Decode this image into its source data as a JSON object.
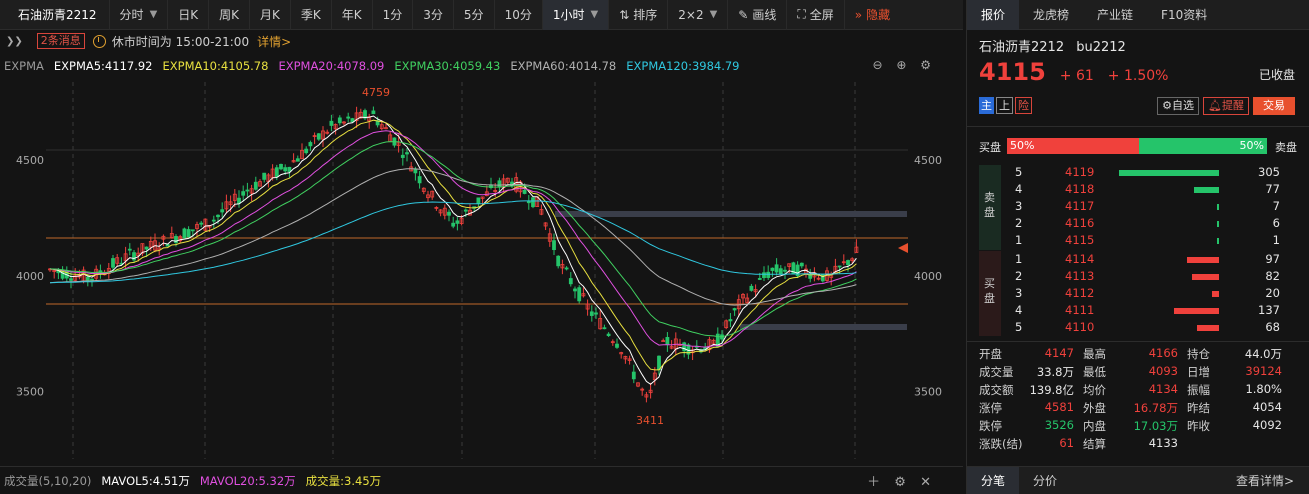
{
  "toolbar": {
    "title": "石油沥青2212",
    "items": [
      "分时",
      "日K",
      "周K",
      "月K",
      "季K",
      "年K",
      "1分",
      "3分",
      "5分",
      "10分",
      "1小时",
      "排序",
      "2×2",
      "画线",
      "全屏",
      "隐藏"
    ],
    "active": "1小时"
  },
  "subbar": {
    "news": "2条消息",
    "rest_time": "休市时间为 15:00-21:00",
    "detail": "详情>"
  },
  "ma_bar": {
    "label": "EXPMA",
    "items": [
      {
        "text": "EXPMA5:4117.92",
        "color": "#ffffff"
      },
      {
        "text": "EXPMA10:4105.78",
        "color": "#e8e040"
      },
      {
        "text": "EXPMA20:4078.09",
        "color": "#e050e0"
      },
      {
        "text": "EXPMA30:4059.43",
        "color": "#40d060"
      },
      {
        "text": "EXPMA60:4014.78",
        "color": "#b0b0b0"
      },
      {
        "text": "EXPMA120:3984.79",
        "color": "#30c8e0"
      }
    ]
  },
  "chart": {
    "y_ticks": [
      "4500",
      "4000",
      "3500"
    ],
    "high_label": "4759",
    "low_label": "3411"
  },
  "vol_bar": {
    "label": "成交量(5,10,20)",
    "items": [
      {
        "text": "MAVOL5:4.51万",
        "color": "#ffffff"
      },
      {
        "text": "MAVOL20:5.32万",
        "color": "#e050e0"
      },
      {
        "text": "成交量:3.45万",
        "color": "#e8e040"
      }
    ]
  },
  "quote": {
    "tabs": [
      "报价",
      "龙虎榜",
      "产业链",
      "F10资料"
    ],
    "name": "石油沥青2212",
    "code": "bu2212",
    "price": "4115",
    "change": "+ 61",
    "change_pct": "+ 1.50%",
    "status": "已收盘",
    "tags": [
      "主",
      "上",
      "险"
    ],
    "buttons": {
      "watch": "自选",
      "alert": "提醒",
      "trade": "交易"
    },
    "ratio": {
      "buy_label": "买盘",
      "sell_label": "卖盘",
      "buy_pct": "50%",
      "sell_pct": "50%"
    },
    "sell_side_label": "卖盘",
    "buy_side_label": "买盘",
    "asks": [
      {
        "level": "5",
        "price": "4119",
        "vol": "305"
      },
      {
        "level": "4",
        "price": "4118",
        "vol": "77"
      },
      {
        "level": "3",
        "price": "4117",
        "vol": "7"
      },
      {
        "level": "2",
        "price": "4116",
        "vol": "6"
      },
      {
        "level": "1",
        "price": "4115",
        "vol": "1"
      }
    ],
    "bids": [
      {
        "level": "1",
        "price": "4114",
        "vol": "97"
      },
      {
        "level": "2",
        "price": "4113",
        "vol": "82"
      },
      {
        "level": "3",
        "price": "4112",
        "vol": "20"
      },
      {
        "level": "4",
        "price": "4111",
        "vol": "137"
      },
      {
        "level": "5",
        "price": "4110",
        "vol": "68"
      }
    ],
    "stats": [
      [
        {
          "k": "开盘",
          "v": "4147",
          "c": "red"
        },
        {
          "k": "最高",
          "v": "4166",
          "c": "red"
        },
        {
          "k": "持仓",
          "v": "44.0万",
          "c": "white"
        }
      ],
      [
        {
          "k": "成交量",
          "v": "33.8万",
          "c": "white"
        },
        {
          "k": "最低",
          "v": "4093",
          "c": "red"
        },
        {
          "k": "日增",
          "v": "39124",
          "c": "red"
        }
      ],
      [
        {
          "k": "成交额",
          "v": "139.8亿",
          "c": "white"
        },
        {
          "k": "均价",
          "v": "4134",
          "c": "red"
        },
        {
          "k": "振幅",
          "v": "1.80%",
          "c": "white"
        }
      ],
      [
        {
          "k": "涨停",
          "v": "4581",
          "c": "red"
        },
        {
          "k": "外盘",
          "v": "16.78万",
          "c": "red"
        },
        {
          "k": "昨结",
          "v": "4054",
          "c": "white"
        }
      ],
      [
        {
          "k": "跌停",
          "v": "3526",
          "c": "green"
        },
        {
          "k": "内盘",
          "v": "17.03万",
          "c": "green"
        },
        {
          "k": "昨收",
          "v": "4092",
          "c": "white"
        }
      ],
      [
        {
          "k": "涨跌(结)",
          "v": "61",
          "c": "red"
        },
        {
          "k": "结算",
          "v": "4133",
          "c": "white"
        },
        {
          "k": "",
          "v": "",
          "c": "white"
        }
      ]
    ],
    "bottom_tabs": [
      "分笔",
      "分价"
    ],
    "more": "查看详情>"
  }
}
